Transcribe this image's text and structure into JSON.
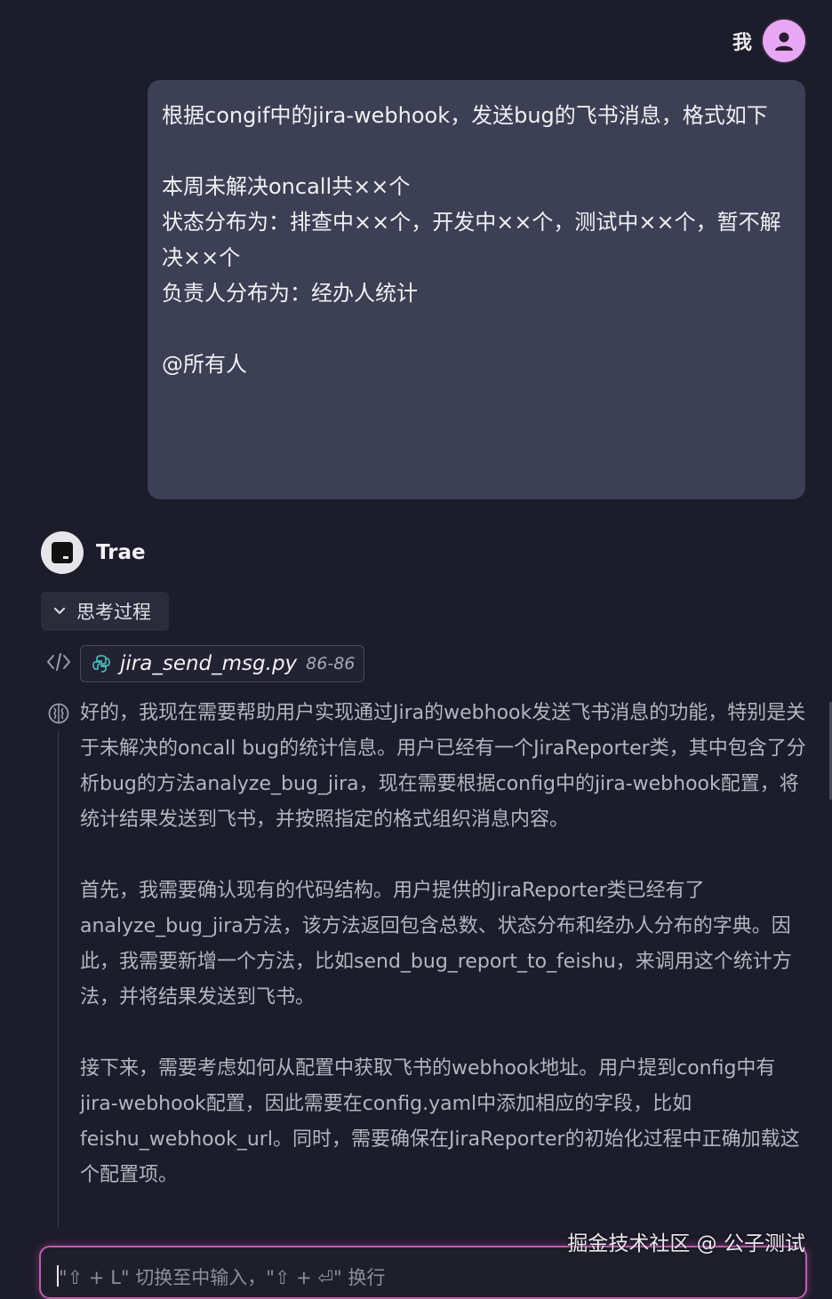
{
  "user": {
    "name": "我",
    "message": "根据congif中的jira-webhook，发送bug的飞书消息，格式如下\n\n本周未解决oncall共××个\n状态分布为：排查中××个，开发中××个，测试中××个，暂不解决××个\n负责人分布为：经办人统计\n\n@所有人"
  },
  "assistant": {
    "name": "Trae",
    "thinking_label": "思考过程",
    "file": {
      "name": "jira_send_msg.py",
      "range": "86-86"
    },
    "paragraphs": [
      "好的，我现在需要帮助用户实现通过Jira的webhook发送飞书消息的功能，特别是关于未解决的oncall bug的统计信息。用户已经有一个JiraReporter类，其中包含了分析bug的方法analyze_bug_jira，现在需要根据config中的jira-webhook配置，将统计结果发送到飞书，并按照指定的格式组织消息内容。",
      "首先，我需要确认现有的代码结构。用户提供的JiraReporter类已经有了analyze_bug_jira方法，该方法返回包含总数、状态分布和经办人分布的字典。因此，我需要新增一个方法，比如send_bug_report_to_feishu，来调用这个统计方法，并将结果发送到飞书。",
      "接下来，需要考虑如何从配置中获取飞书的webhook地址。用户提到config中有jira-webhook配置，因此需要在config.yaml中添加相应的字段，比如feishu_webhook_url。同时，需要确保在JiraReporter的初始化过程中正确加载这个配置项。"
    ]
  },
  "input": {
    "placeholder": "\"⇧ + L\" 切换至中输入，\"⇧ + ⏎\" 换行"
  },
  "watermark": "掘金技术社区 @ 公子测试",
  "colors": {
    "background": "#1c1c2a",
    "user_bubble": "#3d3f54",
    "avatar": "#e9a6f5",
    "input_border": "#c35cae"
  }
}
